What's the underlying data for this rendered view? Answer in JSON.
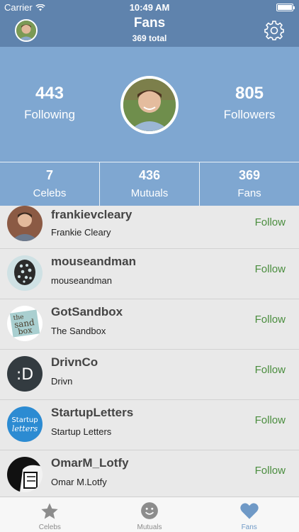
{
  "status_bar": {
    "carrier": "Carrier",
    "time": "10:49 AM"
  },
  "nav": {
    "title": "Fans",
    "subtitle": "369 total",
    "settings_icon": "gear-icon"
  },
  "profile": {
    "following": {
      "count": "443",
      "label": "Following"
    },
    "followers": {
      "count": "805",
      "label": "Followers"
    }
  },
  "stats": [
    {
      "count": "7",
      "label": "Celebs"
    },
    {
      "count": "436",
      "label": "Mutuals"
    },
    {
      "count": "369",
      "label": "Fans"
    }
  ],
  "users": [
    {
      "username": "frankievcleary",
      "display_name": "Frankie Cleary",
      "action": "Follow"
    },
    {
      "username": "mouseandman",
      "display_name": "mouseandman",
      "action": "Follow"
    },
    {
      "username": "GotSandbox",
      "display_name": "The Sandbox",
      "action": "Follow"
    },
    {
      "username": "DrivnCo",
      "display_name": "Drivn",
      "action": "Follow"
    },
    {
      "username": "StartupLetters",
      "display_name": "Startup Letters",
      "action": "Follow"
    },
    {
      "username": "OmarM_Lotfy",
      "display_name": "Omar M.Lotfy",
      "action": "Follow"
    }
  ],
  "avatar_text": {
    "sandbox_line1": "the",
    "sandbox_line2": "sand",
    "sandbox_line3": "box",
    "drivn_mark": ":D",
    "startup_line1": "Startup",
    "startup_line2": "letters"
  },
  "tab_bar": [
    {
      "label": "Celebs",
      "icon": "star-icon"
    },
    {
      "label": "Mutuals",
      "icon": "smiley-icon"
    },
    {
      "label": "Fans",
      "icon": "heart-icon",
      "active": true
    }
  ],
  "colors": {
    "nav_bg": "#5f83ad",
    "header_bg": "#7fa7d1",
    "follow_green": "#4a8d3e",
    "active_tab": "#6f99c6"
  }
}
